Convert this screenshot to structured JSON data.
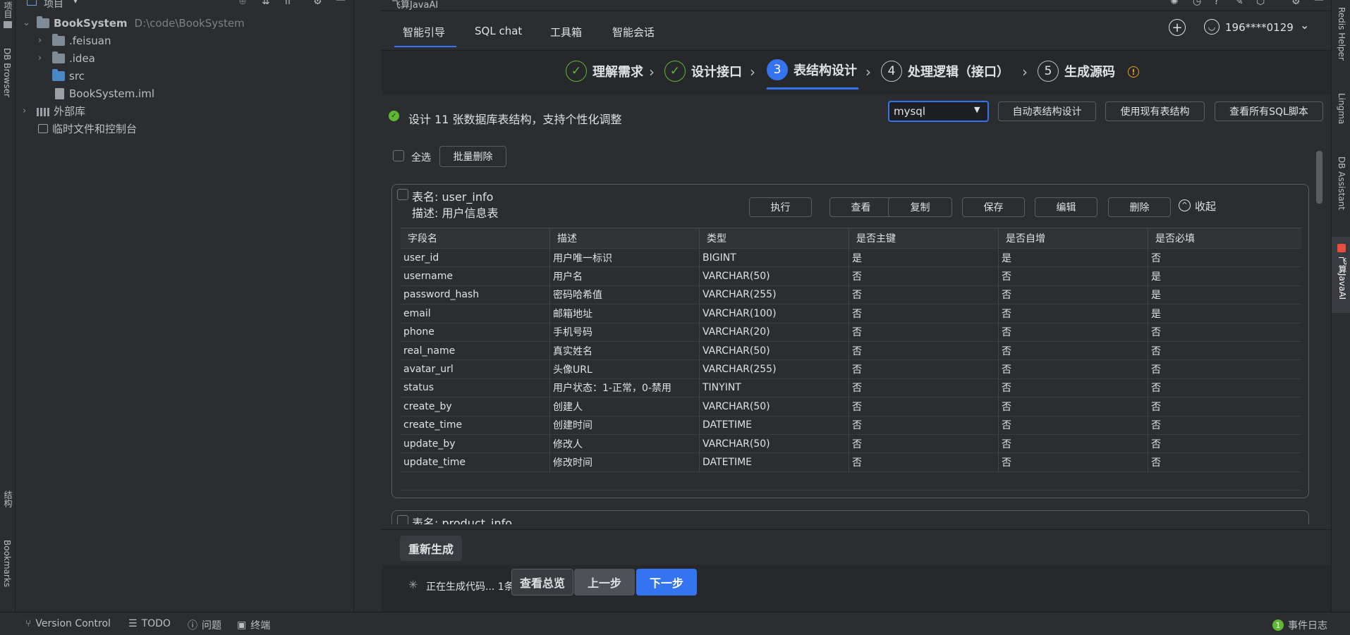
{
  "left_stripe": {
    "project_label": "项目",
    "db_browser": "DB Browser",
    "structure": "结构",
    "bookmarks": "Bookmarks"
  },
  "project_panel": {
    "title": "项目",
    "tree": [
      {
        "label": "BookSystem",
        "path": "D:\\code\\BookSystem"
      },
      {
        "label": ".feisuan"
      },
      {
        "label": ".idea"
      },
      {
        "label": "src"
      },
      {
        "label": "BookSystem.iml"
      },
      {
        "label": "外部库"
      },
      {
        "label": "临时文件和控制台"
      }
    ]
  },
  "plugin": {
    "title": "飞算JavaAI",
    "tabs": [
      "智能引导",
      "SQL chat",
      "工具箱",
      "智能会话"
    ],
    "user": "196****0129",
    "steps": [
      {
        "num": "✓",
        "label": "理解需求"
      },
      {
        "num": "✓",
        "label": "设计接口"
      },
      {
        "num": "3",
        "label": "表结构设计"
      },
      {
        "num": "4",
        "label": "处理逻辑（接口）"
      },
      {
        "num": "5",
        "label": "生成源码"
      }
    ],
    "summary": "设计 11 张数据库表结构，支持个性化调整",
    "db_select": "mysql",
    "actions": [
      "自动表结构设计",
      "使用现有表结构",
      "查看所有SQL脚本"
    ],
    "select_all": "全选",
    "batch_delete": "批量删除",
    "table": {
      "name": "表名: user_info",
      "desc": "描述: 用户信息表",
      "buttons": [
        "执行",
        "查看",
        "复制",
        "保存",
        "编辑",
        "删除"
      ],
      "collapse": "收起",
      "columns": [
        "字段名",
        "描述",
        "类型",
        "是否主键",
        "是否自增",
        "是否必填"
      ],
      "rows": [
        [
          "user_id",
          "用户唯一标识",
          "BIGINT",
          "是",
          "是",
          "否"
        ],
        [
          "username",
          "用户名",
          "VARCHAR(50)",
          "否",
          "否",
          "是"
        ],
        [
          "password_hash",
          "密码哈希值",
          "VARCHAR(255)",
          "否",
          "否",
          "是"
        ],
        [
          "email",
          "邮箱地址",
          "VARCHAR(100)",
          "否",
          "否",
          "是"
        ],
        [
          "phone",
          "手机号码",
          "VARCHAR(20)",
          "否",
          "否",
          "否"
        ],
        [
          "real_name",
          "真实姓名",
          "VARCHAR(50)",
          "否",
          "否",
          "否"
        ],
        [
          "avatar_url",
          "头像URL",
          "VARCHAR(255)",
          "否",
          "否",
          "否"
        ],
        [
          "status",
          "用户状态：1-正常，0-禁用",
          "TINYINT",
          "否",
          "否",
          "否"
        ],
        [
          "create_by",
          "创建人",
          "VARCHAR(50)",
          "否",
          "否",
          "否"
        ],
        [
          "create_time",
          "创建时间",
          "DATETIME",
          "否",
          "否",
          "否"
        ],
        [
          "update_by",
          "修改人",
          "VARCHAR(50)",
          "否",
          "否",
          "否"
        ],
        [
          "update_time",
          "修改时间",
          "DATETIME",
          "否",
          "否",
          "否"
        ]
      ]
    },
    "next_table": "表名: product_info",
    "regenerate": "重新生成",
    "generating": "正在生成代码... 1条",
    "view_overview": "查看总览",
    "prev": "上一步",
    "next": "下一步"
  },
  "right_stripe": [
    "Redis Helper",
    "Lingma",
    "DB Assistant",
    "飞算JavaAI"
  ],
  "statusbar": {
    "vcs": "Version Control",
    "todo": "TODO",
    "problems": "问题",
    "terminal": "终端",
    "events_count": "1",
    "events": "事件日志"
  },
  "colors": {
    "accent": "#3574f0",
    "success": "#5fb832",
    "warning": "#e5a50a",
    "bg": "#2b2d30"
  }
}
